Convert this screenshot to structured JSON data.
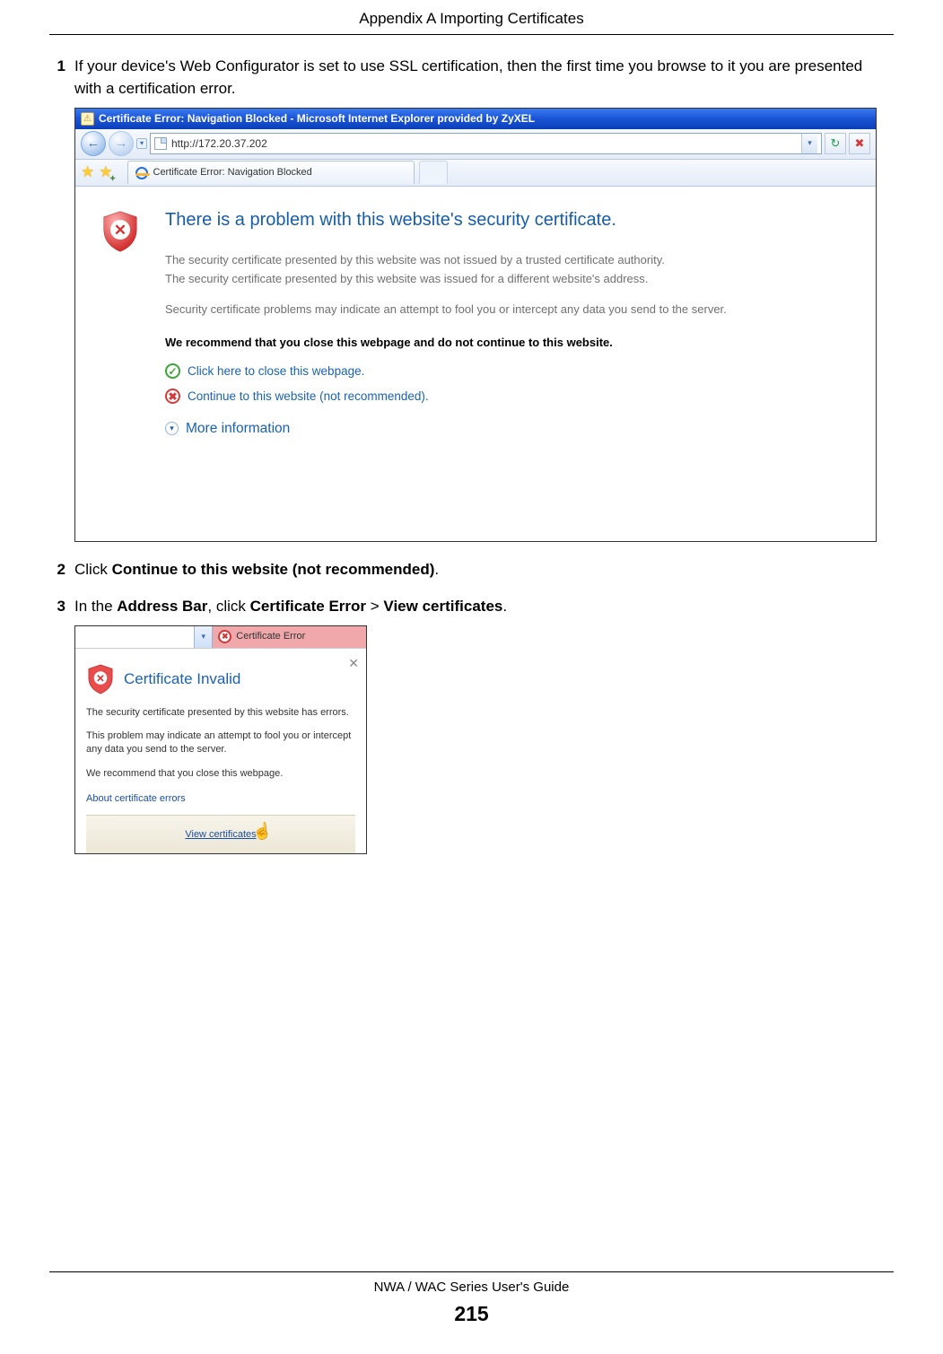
{
  "header": {
    "title": "Appendix A Importing Certificates"
  },
  "steps": {
    "s1_num": "1",
    "s1_text_a": "If your device's Web Configurator is set to use SSL certification, then the first time you browse to it you are presented with a certification error.",
    "s2_num": "2",
    "s2_text_a": "Click ",
    "s2_bold": "Continue to this website (not recommended)",
    "s2_text_b": ".",
    "s3_num": "3",
    "s3_text_a": "In the ",
    "s3_bold1": "Address Bar",
    "s3_text_b": ", click ",
    "s3_bold2": "Certificate Error",
    "s3_text_c": " > ",
    "s3_bold3": "View certificates",
    "s3_text_d": "."
  },
  "ie1": {
    "title": "Certificate Error: Navigation Blocked - Microsoft Internet Explorer provided by ZyXEL",
    "url": "http://172.20.37.202",
    "tab": "Certificate Error: Navigation Blocked",
    "h1": "There is a problem with this website's security certificate.",
    "p1": "The security certificate presented by this website was not issued by a trusted certificate authority.",
    "p2": "The security certificate presented by this website was issued for a different website's address.",
    "p3": "Security certificate problems may indicate an attempt to fool you or intercept any data you send to the server.",
    "recommend": "We recommend that you close this webpage and do not continue to this website.",
    "link_close": "Click here to close this webpage.",
    "link_continue": "Continue to this website (not recommended).",
    "link_more": "More information"
  },
  "ie2": {
    "cert_error": "Certificate Error",
    "h": "Certificate Invalid",
    "p1": "The security certificate presented by this website has errors.",
    "p2": "This problem may indicate an attempt to fool you or intercept any data you send to the server.",
    "p3": "We recommend that you close this webpage.",
    "about": "About certificate errors",
    "view": "View certificates"
  },
  "footer": {
    "guide": "NWA / WAC Series User's Guide",
    "page": "215"
  }
}
